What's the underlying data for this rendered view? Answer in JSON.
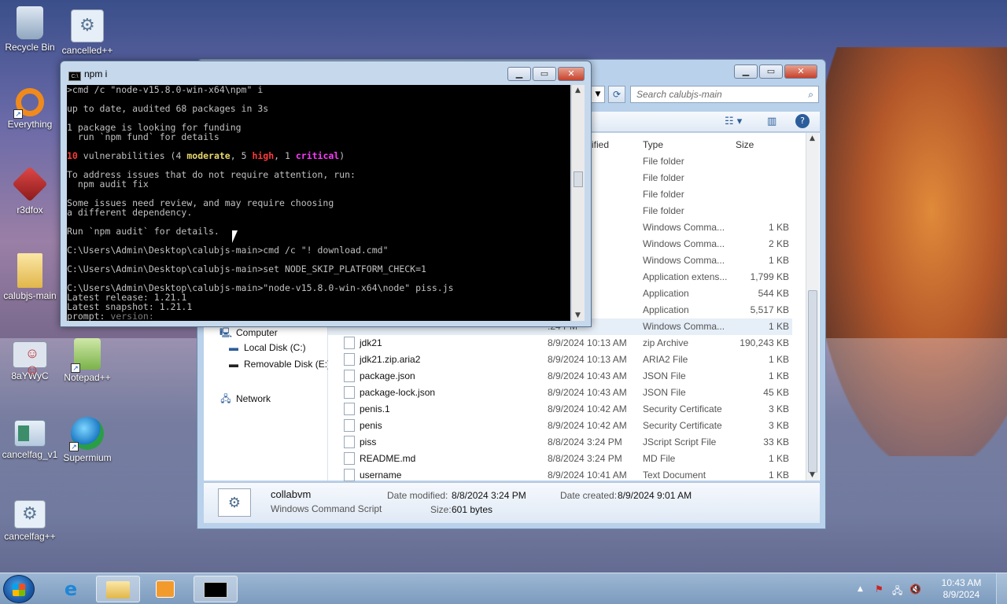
{
  "desktop": {
    "icons": [
      {
        "label": "Recycle Bin",
        "icon": "recycle-bin-icon"
      },
      {
        "label": "cancelled++",
        "icon": "gear-icon"
      },
      {
        "label": "Everything",
        "icon": "magnifier-icon"
      },
      {
        "label": "r3dfox",
        "icon": "fox-browser-icon"
      },
      {
        "label": "calubjs-main",
        "icon": "folder-icon"
      },
      {
        "label": "8aYWyC",
        "icon": "people-icon"
      },
      {
        "label": "Notepad++",
        "icon": "notepad-icon"
      },
      {
        "label": "cancelfag_v1",
        "icon": "window-icon"
      },
      {
        "label": "Supermium",
        "icon": "globe-icon"
      },
      {
        "label": "cancelfag++",
        "icon": "gear-icon"
      }
    ]
  },
  "explorer": {
    "search_placeholder": "Search calubjs-main",
    "columns": {
      "modified": "ified",
      "type": "Type",
      "size": "Size"
    },
    "nav": {
      "computer": "Computer",
      "local_disk": "Local Disk (C:)",
      "removable": "Removable Disk (E:)",
      "network": "Network"
    },
    "rows": [
      {
        "name": "",
        "date": "0:12 AM",
        "type": "File folder",
        "size": ""
      },
      {
        "name": "",
        "date": ":26 AM",
        "type": "File folder",
        "size": ""
      },
      {
        "name": "",
        "date": "7:51 PM",
        "type": "File folder",
        "size": ""
      },
      {
        "name": "",
        "date": "0:14 AM",
        "type": "File folder",
        "size": ""
      },
      {
        "name": "",
        "date": ":24 PM",
        "type": "Windows Comma...",
        "size": "1 KB"
      },
      {
        "name": "",
        "date": ":24 PM",
        "type": "Windows Comma...",
        "size": "2 KB"
      },
      {
        "name": "",
        "date": ":24 PM",
        "type": "Windows Comma...",
        "size": "1 KB"
      },
      {
        "name": "",
        "date": ":29 PM",
        "type": "Application extens...",
        "size": "1,799 KB"
      },
      {
        "name": "",
        "date": ":29 PM",
        "type": "Application",
        "size": "544 KB"
      },
      {
        "name": "",
        "date": ":29 PM",
        "type": "Application",
        "size": "5,517 KB"
      },
      {
        "name": "",
        "date": ":24 PM",
        "type": "Windows Comma...",
        "size": "1 KB"
      },
      {
        "name": "jdk21",
        "date": "8/9/2024 10:13 AM",
        "type": "zip Archive",
        "size": "190,243 KB"
      },
      {
        "name": "jdk21.zip.aria2",
        "date": "8/9/2024 10:13 AM",
        "type": "ARIA2 File",
        "size": "1 KB"
      },
      {
        "name": "package.json",
        "date": "8/9/2024 10:43 AM",
        "type": "JSON File",
        "size": "1 KB"
      },
      {
        "name": "package-lock.json",
        "date": "8/9/2024 10:43 AM",
        "type": "JSON File",
        "size": "45 KB"
      },
      {
        "name": "penis.1",
        "date": "8/9/2024 10:42 AM",
        "type": "Security Certificate",
        "size": "3 KB"
      },
      {
        "name": "penis",
        "date": "8/9/2024 10:42 AM",
        "type": "Security Certificate",
        "size": "3 KB"
      },
      {
        "name": "piss",
        "date": "8/8/2024 3:24 PM",
        "type": "JScript Script File",
        "size": "33 KB"
      },
      {
        "name": "README.md",
        "date": "8/8/2024 3:24 PM",
        "type": "MD File",
        "size": "1 KB"
      },
      {
        "name": "username",
        "date": "8/9/2024 10:41 AM",
        "type": "Text Document",
        "size": "1 KB"
      }
    ],
    "details": {
      "name": "collabvm",
      "type": "Windows Command Script",
      "modified_label": "Date modified:",
      "modified": "8/8/2024 3:24 PM",
      "created_label": "Date created:",
      "created": "8/9/2024 9:01 AM",
      "size_label": "Size:",
      "size": "601 bytes"
    }
  },
  "console": {
    "title": "npm i",
    "lines": [
      ">cmd /c \"node-v15.8.0-win-x64\\npm\" i",
      "",
      "up to date, audited 68 packages in 3s",
      "",
      "1 package is looking for funding",
      "  run `npm fund` for details",
      "",
      "",
      "",
      "To address issues that do not require attention, run:",
      "  npm audit fix",
      "",
      "Some issues need review, and may require choosing",
      "a different dependency.",
      "",
      "Run `npm audit` for details.",
      "",
      "C:\\Users\\Admin\\Desktop\\calubjs-main>cmd /c \"! download.cmd\"",
      "",
      "C:\\Users\\Admin\\Desktop\\calubjs-main>set NODE_SKIP_PLATFORM_CHECK=1",
      "",
      "C:\\Users\\Admin\\Desktop\\calubjs-main>\"node-v15.8.0-win-x64\\node\" piss.js",
      "Latest release: 1.21.1",
      "Latest snapshot: 1.21.1"
    ],
    "vuln": {
      "count": "10",
      "pre": " vulnerabilities (4 ",
      "moderate": "moderate",
      "mid": ", 5 ",
      "high": "high",
      "mid2": ", 1 ",
      "critical": "critical",
      "post": ")"
    },
    "prompt": {
      "label": "prompt: ",
      "hint": "version: "
    }
  },
  "taskbar": {
    "clock_time": "10:43 AM",
    "clock_date": "8/9/2024",
    "tray_up": "▲"
  }
}
